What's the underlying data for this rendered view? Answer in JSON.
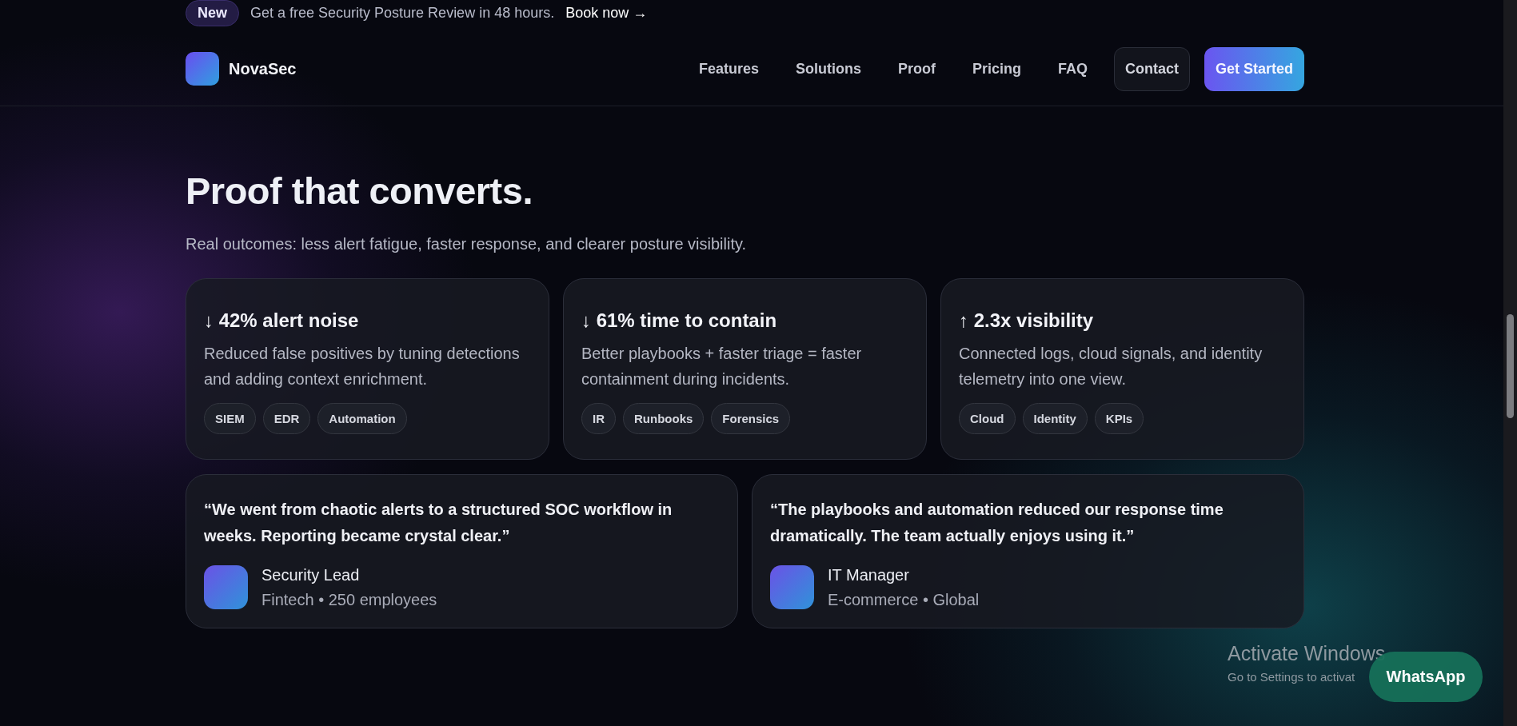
{
  "announcement": {
    "badge": "New",
    "text": "Get a free Security Posture Review in 48 hours.",
    "link": "Book now →"
  },
  "nav": {
    "brand": "NovaSec",
    "links": [
      {
        "label": "Features",
        "kind": "plain"
      },
      {
        "label": "Solutions",
        "kind": "plain"
      },
      {
        "label": "Proof",
        "kind": "plain"
      },
      {
        "label": "Pricing",
        "kind": "plain"
      },
      {
        "label": "FAQ",
        "kind": "plain"
      },
      {
        "label": "Contact",
        "kind": "outline"
      },
      {
        "label": "Get Started",
        "kind": "primary"
      }
    ]
  },
  "section": {
    "title": "Proof that converts.",
    "subtitle": "Real outcomes: less alert fatigue, faster response, and clearer posture visibility."
  },
  "metrics": [
    {
      "title": "↓ 42% alert noise",
      "text": "Reduced false positives by tuning detections and adding context enrichment.",
      "tags": [
        "SIEM",
        "EDR",
        "Automation"
      ]
    },
    {
      "title": "↓ 61% time to contain",
      "text": "Better playbooks + faster triage = faster containment during incidents.",
      "tags": [
        "IR",
        "Runbooks",
        "Forensics"
      ]
    },
    {
      "title": "↑ 2.3x visibility",
      "text": "Connected logs, cloud signals, and identity telemetry into one view.",
      "tags": [
        "Cloud",
        "Identity",
        "KPIs"
      ]
    }
  ],
  "testimonials": [
    {
      "quote": "“We went from chaotic alerts to a structured SOC workflow in weeks. Reporting became crystal clear.”",
      "role": "Security Lead",
      "meta": "Fintech • 250 employees"
    },
    {
      "quote": "“The playbooks and automation reduced our response time dramatically. The team actually enjoys using it.”",
      "role": "IT Manager",
      "meta": "E-commerce • Global"
    }
  ],
  "os_notice": {
    "title": "Activate Windows",
    "text": "Go to Settings to activat"
  },
  "chat_button": {
    "label": "WhatsApp"
  }
}
